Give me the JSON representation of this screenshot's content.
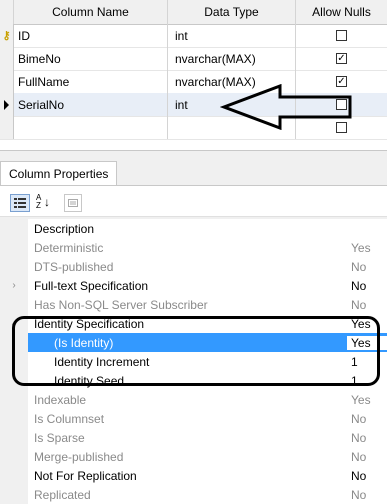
{
  "grid": {
    "headers": [
      "Column Name",
      "Data Type",
      "Allow Nulls"
    ],
    "rows": [
      {
        "name": "ID",
        "type": "int",
        "allow_nulls": false,
        "key": true
      },
      {
        "name": "BimeNo",
        "type": "nvarchar(MAX)",
        "allow_nulls": true,
        "key": false
      },
      {
        "name": "FullName",
        "type": "nvarchar(MAX)",
        "allow_nulls": true,
        "key": false
      },
      {
        "name": "SerialNo",
        "type": "int",
        "allow_nulls": false,
        "key": false,
        "current": true
      },
      {
        "name": "",
        "type": "",
        "allow_nulls": false,
        "key": false
      }
    ]
  },
  "properties_pane": {
    "tab_label": "Column Properties",
    "toolbar_icons": [
      "categorized-icon",
      "alphabetical-sort-icon",
      "property-pages-icon"
    ],
    "sort_label": "A Z",
    "rows": [
      {
        "name": "Description",
        "value": "",
        "disabled": false,
        "indent": false,
        "expander": ""
      },
      {
        "name": "Deterministic",
        "value": "Yes",
        "disabled": true,
        "indent": false,
        "expander": ""
      },
      {
        "name": "DTS-published",
        "value": "No",
        "disabled": true,
        "indent": false,
        "expander": ""
      },
      {
        "name": "Full-text Specification",
        "value": "No",
        "disabled": false,
        "indent": false,
        "expander": ">"
      },
      {
        "name": "Has Non-SQL Server Subscriber",
        "value": "No",
        "disabled": true,
        "indent": false,
        "expander": ""
      },
      {
        "name": "Identity Specification",
        "value": "Yes",
        "disabled": false,
        "indent": false,
        "expander": "v"
      },
      {
        "name": "(Is Identity)",
        "value": "Yes",
        "disabled": false,
        "indent": true,
        "expander": "",
        "selected": true
      },
      {
        "name": "Identity Increment",
        "value": "1",
        "disabled": false,
        "indent": true,
        "expander": ""
      },
      {
        "name": "Identity Seed",
        "value": "1",
        "disabled": false,
        "indent": true,
        "expander": ""
      },
      {
        "name": "Indexable",
        "value": "Yes",
        "disabled": true,
        "indent": false,
        "expander": ""
      },
      {
        "name": "Is Columnset",
        "value": "No",
        "disabled": true,
        "indent": false,
        "expander": ""
      },
      {
        "name": "Is Sparse",
        "value": "No",
        "disabled": true,
        "indent": false,
        "expander": ""
      },
      {
        "name": "Merge-published",
        "value": "No",
        "disabled": true,
        "indent": false,
        "expander": ""
      },
      {
        "name": "Not For Replication",
        "value": "No",
        "disabled": false,
        "indent": false,
        "expander": ""
      },
      {
        "name": "Replicated",
        "value": "No",
        "disabled": true,
        "indent": false,
        "expander": ""
      }
    ]
  },
  "annotations": [
    "arrow-pointing-to-serialno-row",
    "circle-around-identity-specification"
  ]
}
